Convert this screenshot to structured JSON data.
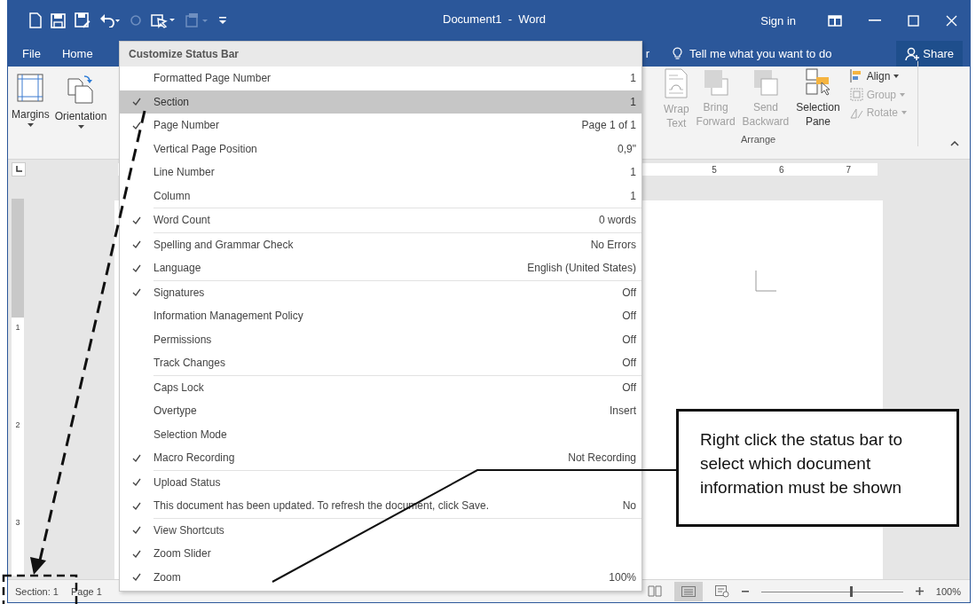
{
  "window": {
    "title": "Document1  -  Word",
    "sign_in": "Sign in"
  },
  "tabs": [
    {
      "label": "File"
    },
    {
      "label": "Home"
    },
    {
      "label": "r"
    }
  ],
  "tell_me": {
    "placeholder": "Tell me what you want to do"
  },
  "share": "Share",
  "ribbon": {
    "page_buttons": [
      {
        "label": "Margins",
        "kind": "margins"
      },
      {
        "label": "Orientation",
        "kind": "orientation"
      }
    ],
    "arrange": {
      "label": "Arrange",
      "large": [
        {
          "lines": [
            "Wrap",
            "Text"
          ],
          "kind": "wrap",
          "disabled": true
        },
        {
          "lines": [
            "Bring",
            "Forward"
          ],
          "kind": "bring",
          "disabled": true
        },
        {
          "lines": [
            "Send",
            "Backward"
          ],
          "kind": "send",
          "disabled": true
        },
        {
          "lines": [
            "Selection",
            "Pane"
          ],
          "kind": "selection",
          "disabled": false
        }
      ],
      "small": [
        {
          "label": "Align",
          "kind": "align",
          "disabled": false
        },
        {
          "label": "Group",
          "kind": "group",
          "disabled": true
        },
        {
          "label": "Rotate",
          "kind": "rotate",
          "disabled": true
        }
      ]
    }
  },
  "ruler": {
    "marks": [
      "5",
      "6",
      "7"
    ]
  },
  "vertical_ruler": {
    "marks": [
      "1",
      "2",
      "3"
    ]
  },
  "menu": {
    "title": "Customize Status Bar",
    "groups": [
      [
        {
          "label": "Formatted Page Number",
          "value": "1",
          "checked": false,
          "selected": false
        },
        {
          "label": "Section",
          "value": "1",
          "checked": true,
          "selected": true
        },
        {
          "label": "Page Number",
          "value": "Page 1 of 1",
          "checked": true,
          "selected": false
        },
        {
          "label": "Vertical Page Position",
          "value": "0,9\"",
          "checked": false,
          "selected": false
        },
        {
          "label": "Line Number",
          "value": "1",
          "checked": false,
          "selected": false
        },
        {
          "label": "Column",
          "value": "1",
          "checked": false,
          "selected": false
        }
      ],
      [
        {
          "label": "Word Count",
          "value": "0 words",
          "checked": true,
          "selected": false
        }
      ],
      [
        {
          "label": "Spelling and Grammar Check",
          "value": "No Errors",
          "checked": true,
          "selected": false
        },
        {
          "label": "Language",
          "value": "English (United States)",
          "checked": true,
          "selected": false
        }
      ],
      [
        {
          "label": "Signatures",
          "value": "Off",
          "checked": true,
          "selected": false
        },
        {
          "label": "Information Management Policy",
          "value": "Off",
          "checked": false,
          "selected": false
        },
        {
          "label": "Permissions",
          "value": "Off",
          "checked": false,
          "selected": false
        },
        {
          "label": "Track Changes",
          "value": "Off",
          "checked": false,
          "selected": false
        }
      ],
      [
        {
          "label": "Caps Lock",
          "value": "Off",
          "checked": false,
          "selected": false
        },
        {
          "label": "Overtype",
          "value": "Insert",
          "checked": false,
          "selected": false
        },
        {
          "label": "Selection Mode",
          "checked": false,
          "selected": false
        },
        {
          "label": "Macro Recording",
          "value": "Not Recording",
          "checked": true,
          "selected": false
        }
      ],
      [
        {
          "label": "Upload Status",
          "checked": true,
          "selected": false
        },
        {
          "label": "This document has been updated. To refresh the document, click Save.",
          "value": "No",
          "checked": true,
          "selected": false
        }
      ],
      [
        {
          "label": "View Shortcuts",
          "checked": true,
          "selected": false
        },
        {
          "label": "Zoom Slider",
          "checked": true,
          "selected": false
        },
        {
          "label": "Zoom",
          "value": "100%",
          "checked": true,
          "selected": false
        }
      ]
    ]
  },
  "status_bar": {
    "items": [
      "Section: 1",
      "Page 1"
    ],
    "zoom": {
      "level": 0.63,
      "reading": "100%"
    }
  },
  "callout": {
    "text": "Right click the status bar to select which document information must be shown"
  }
}
